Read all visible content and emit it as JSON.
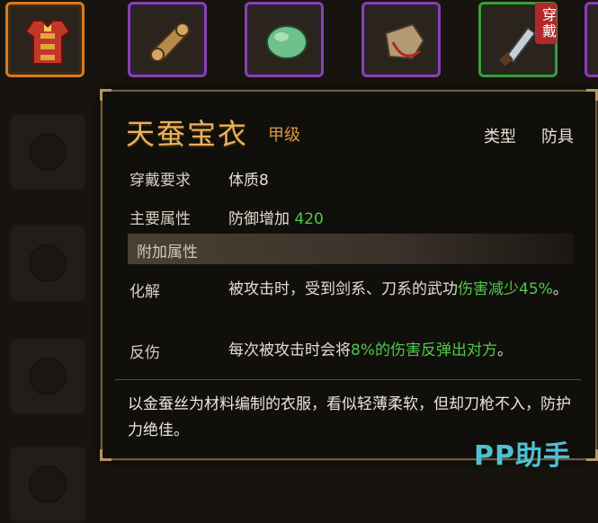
{
  "inventory": {
    "slots": [
      {
        "icon": "armor-icon",
        "rarity_color": "#d97a18"
      },
      {
        "icon": "scroll-icon",
        "rarity_color": "#8a3fb0"
      },
      {
        "icon": "jade-icon",
        "rarity_color": "#8a3fb0"
      },
      {
        "icon": "pouch-icon",
        "rarity_color": "#8a3fb0"
      },
      {
        "icon": "blade-icon",
        "rarity_color": "#3c9a3a",
        "tag": "穿戴"
      }
    ]
  },
  "tooltip": {
    "name": "天蚕宝衣",
    "grade": "甲级",
    "type_label": "类型",
    "type_value": "防具",
    "requirement_label": "穿戴要求",
    "requirement_value": "体质8",
    "main_attr_label": "主要属性",
    "main_attr_text": "防御增加",
    "main_attr_number": "420",
    "extra_section": "附加属性",
    "effect1_label": "化解",
    "effect1_text": "被攻击时，受到剑系、刀系的武功",
    "effect1_highlight": "伤害减少45%",
    "effect1_end": "。",
    "effect2_label": "反伤",
    "effect2_text": "每次被攻击时会将",
    "effect2_highlight": "8%的伤害反弹出对方",
    "effect2_end": "。",
    "description": "以金蚕丝为材料编制的衣服，看似轻薄柔软，但却刀枪不入，防护力绝佳。"
  },
  "watermark": "PP助手",
  "colors": {
    "name_gold": "#e6b35c",
    "highlight_green": "#4fc94c",
    "watermark_cyan": "#4ec0d4"
  }
}
